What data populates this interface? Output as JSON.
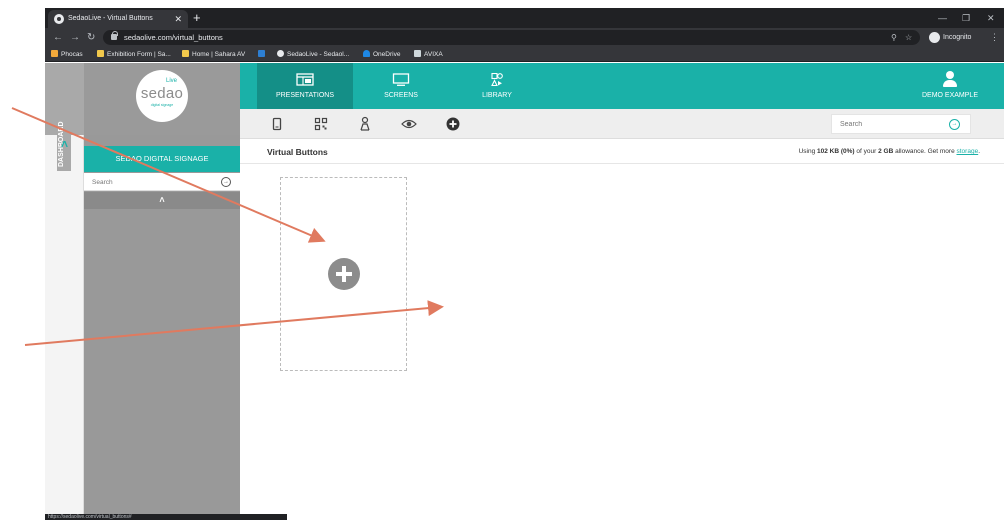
{
  "browser": {
    "tab_title": "SedaoLive - Virtual Buttons",
    "tab_close": "✕",
    "new_tab": "+",
    "url": "sedaolive.com/virtual_buttons",
    "incognito_label": "Incognito",
    "bookmarks": [
      {
        "label": "Phocas",
        "color": "#f2a93b"
      },
      {
        "label": "Exhibition Form | Sa...",
        "color": "#f2c94c"
      },
      {
        "label": "Home | Sahara AV",
        "color": "#f2c94c"
      },
      {
        "label": "",
        "color": "#2d7fd3"
      },
      {
        "label": "SedaoLive - Sedaol...",
        "color": "#e8eaed"
      },
      {
        "label": "OneDrive",
        "color": "#1e88e5"
      },
      {
        "label": "AVIXA",
        "color": "#cfd8dc"
      }
    ],
    "status_text": "https://sedaolive.com/virtual_buttons#"
  },
  "rail": {
    "label": "DASHBOARD"
  },
  "sidebar": {
    "logo_text": "sedao",
    "logo_live": "Live",
    "logo_tagline": "digital signage",
    "title": "SEDAO DIGITAL SIGNAGE",
    "search_placeholder": "Search"
  },
  "nav": {
    "tabs": [
      {
        "label": "PRESENTATIONS",
        "icon": "presentation-icon",
        "active": true
      },
      {
        "label": "SCREENS",
        "icon": "monitor-icon",
        "active": false
      },
      {
        "label": "LIBRARY",
        "icon": "library-icon",
        "active": false
      }
    ],
    "user_label": "DEMO EXAMPLE"
  },
  "toolbar": {
    "tools": [
      "mobile-icon",
      "qr-code-icon",
      "person-icon",
      "eye-icon",
      "add-icon"
    ],
    "search_placeholder": "Search"
  },
  "content": {
    "page_title": "Virtual Buttons",
    "usage_prefix": "Using ",
    "usage_used": "102 KB (0%)",
    "usage_mid": " of your ",
    "usage_total": "2 GB",
    "usage_suffix": " allowance. Get more ",
    "usage_link": "storage",
    "usage_end": "."
  },
  "colors": {
    "accent": "#1ab1a8",
    "accent_dark": "#148f87",
    "annotation_arrow": "#e07a5f",
    "sidebar_gray": "#999999"
  }
}
